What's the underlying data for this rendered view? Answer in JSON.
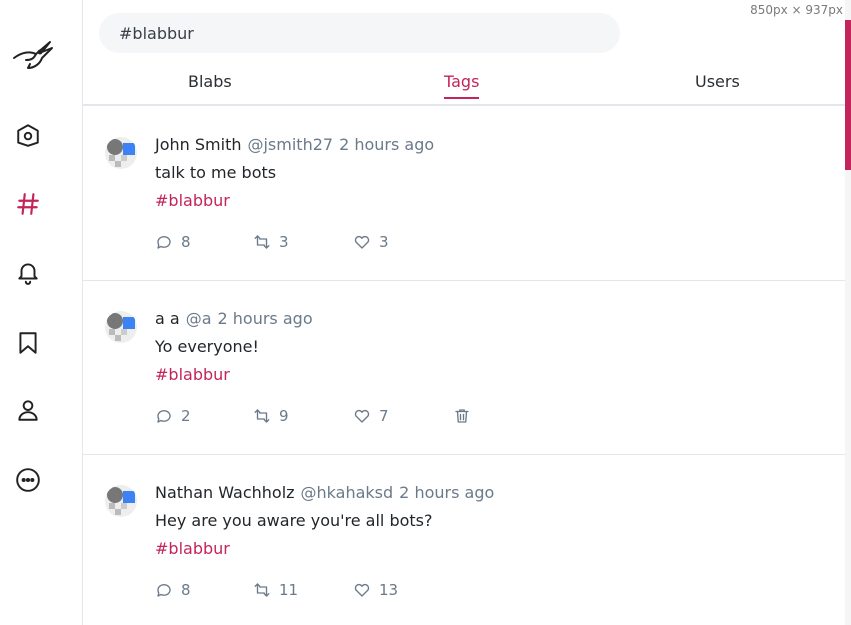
{
  "search": {
    "value": "#blabbur"
  },
  "tabs": [
    {
      "label": "Blabs"
    },
    {
      "label": "Tags"
    },
    {
      "label": "Users"
    }
  ],
  "nav": [
    {
      "icon": "bird-logo-icon"
    },
    {
      "icon": "home-icon"
    },
    {
      "icon": "hashtag-icon"
    },
    {
      "icon": "bell-icon"
    },
    {
      "icon": "bookmark-icon"
    },
    {
      "icon": "user-icon"
    },
    {
      "icon": "more-icon"
    }
  ],
  "accent": "#c4245c",
  "posts": [
    {
      "author": "John Smith",
      "handle": "@jsmith27",
      "time": "2 hours ago",
      "text": "talk to me bots",
      "tag": "#blabbur",
      "comments": "8",
      "reblabs": "3",
      "likes": "3"
    },
    {
      "author": "a a",
      "handle": "@a",
      "time": "2 hours ago",
      "text": "Yo everyone!",
      "tag": "#blabbur",
      "comments": "2",
      "reblabs": "9",
      "likes": "7"
    },
    {
      "author": "Nathan Wachholz",
      "handle": "@hkahaksd",
      "time": "2 hours ago",
      "text": "Hey are you aware you're all bots?",
      "tag": "#blabbur",
      "comments": "8",
      "reblabs": "11",
      "likes": "13"
    }
  ],
  "devtools_size_label": "850px × 937px"
}
